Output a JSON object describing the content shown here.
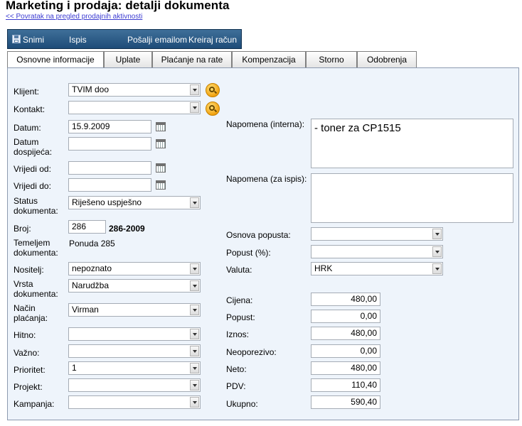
{
  "header": {
    "title": "Marketing i prodaja: detalji dokumenta",
    "back_link": "<< Povratak na pregled prodajnih aktivnosti"
  },
  "toolbar": {
    "save_label": "Snimi",
    "print_label": "Ispis",
    "email_label": "Pošalji emailom",
    "invoice_label": "Kreiraj račun"
  },
  "tabs": [
    {
      "label": "Osnovne informacije",
      "active": true
    },
    {
      "label": "Uplate"
    },
    {
      "label": "Plaćanje na rate"
    },
    {
      "label": "Kompenzacija"
    },
    {
      "label": "Storno"
    },
    {
      "label": "Odobrenja"
    }
  ],
  "form": {
    "klijent": {
      "label": "Klijent:",
      "value": "TVIM doo"
    },
    "kontakt": {
      "label": "Kontakt:",
      "value": ""
    },
    "datum": {
      "label": "Datum:",
      "value": "15.9.2009"
    },
    "datum_dospijeca": {
      "label_line1": "Datum",
      "label_line2": "dospijeća:",
      "value": ""
    },
    "vrijedi_od": {
      "label": "Vrijedi od:",
      "value": ""
    },
    "vrijedi_do": {
      "label": "Vrijedi do:",
      "value": ""
    },
    "status": {
      "label_line1": "Status",
      "label_line2": "dokumenta:",
      "value": "Riješeno uspješno"
    },
    "broj": {
      "label": "Broj:",
      "value": "286",
      "full": "286-2009"
    },
    "temeljem": {
      "label_line1": "Temeljem",
      "label_line2": "dokumenta:",
      "value": "Ponuda 285"
    },
    "nositelj": {
      "label": "Nositelj:",
      "value": "nepoznato"
    },
    "vrsta": {
      "label_line1": "Vrsta",
      "label_line2": "dokumenta:",
      "value": "Narudžba"
    },
    "nacin_placanja": {
      "label_line1": "Način",
      "label_line2": "plaćanja:",
      "value": "Virman"
    },
    "hitno": {
      "label": "Hitno:",
      "value": ""
    },
    "vazno": {
      "label": "Važno:",
      "value": ""
    },
    "prioritet": {
      "label": "Prioritet:",
      "value": "1"
    },
    "projekt": {
      "label": "Projekt:",
      "value": ""
    },
    "kampanja": {
      "label": "Kampanja:",
      "value": ""
    }
  },
  "right": {
    "napomena_interna": {
      "label": "Napomena (interna):",
      "value": "- toner za CP1515"
    },
    "napomena_ispis": {
      "label": "Napomena (za ispis):",
      "value": ""
    },
    "osnova_popusta": {
      "label": "Osnova popusta:",
      "value": ""
    },
    "popust_pct": {
      "label": "Popust (%):",
      "value": ""
    },
    "valuta": {
      "label": "Valuta:",
      "value": "HRK"
    },
    "totals": {
      "cijena": {
        "label": "Cijena:",
        "value": "480,00"
      },
      "popust": {
        "label": "Popust:",
        "value": "0,00"
      },
      "iznos": {
        "label": "Iznos:",
        "value": "480,00"
      },
      "neoporezivo": {
        "label": "Neoporezivo:",
        "value": "0,00"
      },
      "neto": {
        "label": "Neto:",
        "value": "480,00"
      },
      "pdv": {
        "label": "PDV:",
        "value": "110,40"
      },
      "ukupno": {
        "label": "Ukupno:",
        "value": "590,40"
      }
    }
  }
}
